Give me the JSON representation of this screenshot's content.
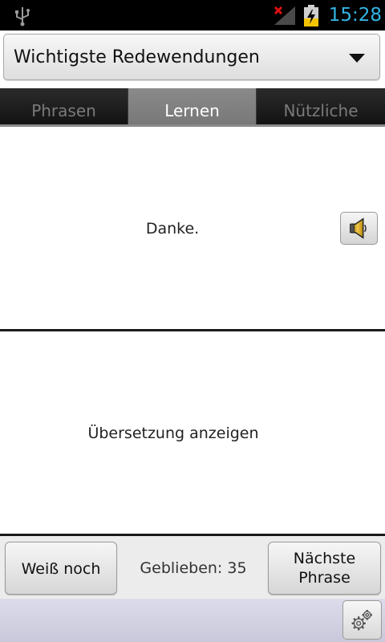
{
  "status_bar": {
    "time": "15:28",
    "icons": [
      "usb-icon",
      "signal-no-connection-icon",
      "battery-charging-icon"
    ],
    "time_color": "#33b5e5"
  },
  "spinner": {
    "selected": "Wichtigste Redewendungen"
  },
  "tabs": [
    {
      "label": "Phrasen",
      "active": false
    },
    {
      "label": "Lernen",
      "active": true
    },
    {
      "label": "Nützliche Wörter",
      "active": false
    }
  ],
  "phrase": {
    "text": "Danke.",
    "sound_icon": "speaker-icon"
  },
  "translation": {
    "text": "Übersetzung anzeigen"
  },
  "bottom": {
    "know_label": "Weiß noch",
    "remaining_label": "Geblieben: 35",
    "next_label": "Nächste Phrase"
  },
  "footer": {
    "settings_icon": "gear-icon"
  }
}
